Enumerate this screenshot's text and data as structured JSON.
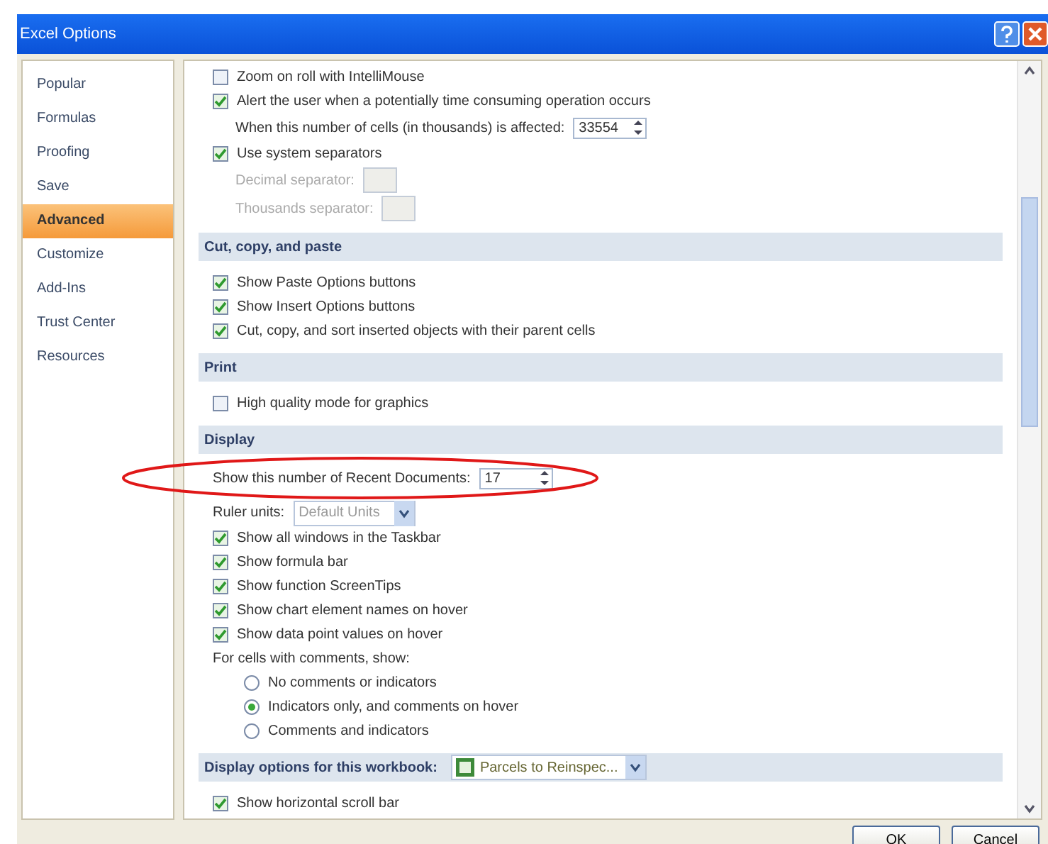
{
  "window": {
    "title": "Excel Options"
  },
  "sidebar": {
    "items": [
      {
        "label": "Popular",
        "selected": false
      },
      {
        "label": "Formulas",
        "selected": false
      },
      {
        "label": "Proofing",
        "selected": false
      },
      {
        "label": "Save",
        "selected": false
      },
      {
        "label": "Advanced",
        "selected": true
      },
      {
        "label": "Customize",
        "selected": false
      },
      {
        "label": "Add-Ins",
        "selected": false
      },
      {
        "label": "Trust Center",
        "selected": false
      },
      {
        "label": "Resources",
        "selected": false
      }
    ]
  },
  "sections": [
    {
      "items": [
        {
          "kind": "checkbox",
          "label": "Zoom on roll with IntelliMouse",
          "checked": false
        },
        {
          "kind": "checkbox",
          "label": "Alert the user when a potentially time consuming operation occurs",
          "checked": true,
          "children": [
            {
              "kind": "spinner",
              "label": "When this number of cells (in thousands) is affected:",
              "value": "33554"
            }
          ]
        },
        {
          "kind": "checkbox",
          "label": "Use system separators",
          "checked": true,
          "children": [
            {
              "kind": "textbox",
              "label": "Decimal separator:",
              "disabled": true
            },
            {
              "kind": "textbox",
              "label": "Thousands separator:",
              "disabled": true
            }
          ]
        }
      ]
    },
    {
      "header": "Cut, copy, and paste",
      "items": [
        {
          "kind": "checkbox",
          "label": "Show Paste Options buttons",
          "checked": true
        },
        {
          "kind": "checkbox",
          "label": "Show Insert Options buttons",
          "checked": true
        },
        {
          "kind": "checkbox",
          "label": "Cut, copy, and sort inserted objects with their parent cells",
          "checked": true
        }
      ]
    },
    {
      "header": "Print",
      "items": [
        {
          "kind": "checkbox",
          "label": "High quality mode for graphics",
          "checked": false
        }
      ]
    },
    {
      "header": "Display",
      "items": [
        {
          "kind": "spinner",
          "label": "Show this number of Recent Documents:",
          "value": "17"
        },
        {
          "kind": "dropdown",
          "label": "Ruler units:",
          "value": "Default Units"
        },
        {
          "kind": "checkbox",
          "label": "Show all windows in the Taskbar",
          "checked": true
        },
        {
          "kind": "checkbox",
          "label": "Show formula bar",
          "checked": true
        },
        {
          "kind": "checkbox",
          "label": "Show function ScreenTips",
          "checked": true
        },
        {
          "kind": "checkbox",
          "label": "Show chart element names on hover",
          "checked": true
        },
        {
          "kind": "checkbox",
          "label": "Show data point values on hover",
          "checked": true
        },
        {
          "kind": "label",
          "label": "For cells with comments, show:",
          "children": [
            {
              "kind": "radio",
              "label": "No comments or indicators",
              "selected": false
            },
            {
              "kind": "radio",
              "label": "Indicators only, and comments on hover",
              "selected": true
            },
            {
              "kind": "radio",
              "label": "Comments and indicators",
              "selected": false
            }
          ]
        }
      ]
    },
    {
      "header": "Display options for this workbook:",
      "header_dropdown": "Parcels to Reinspec...",
      "items": [
        {
          "kind": "checkbox",
          "label": "Show horizontal scroll bar",
          "checked": true
        }
      ]
    }
  ],
  "annotation": {
    "kind": "ellipse"
  },
  "buttons": [
    "OK",
    "Cancel"
  ]
}
